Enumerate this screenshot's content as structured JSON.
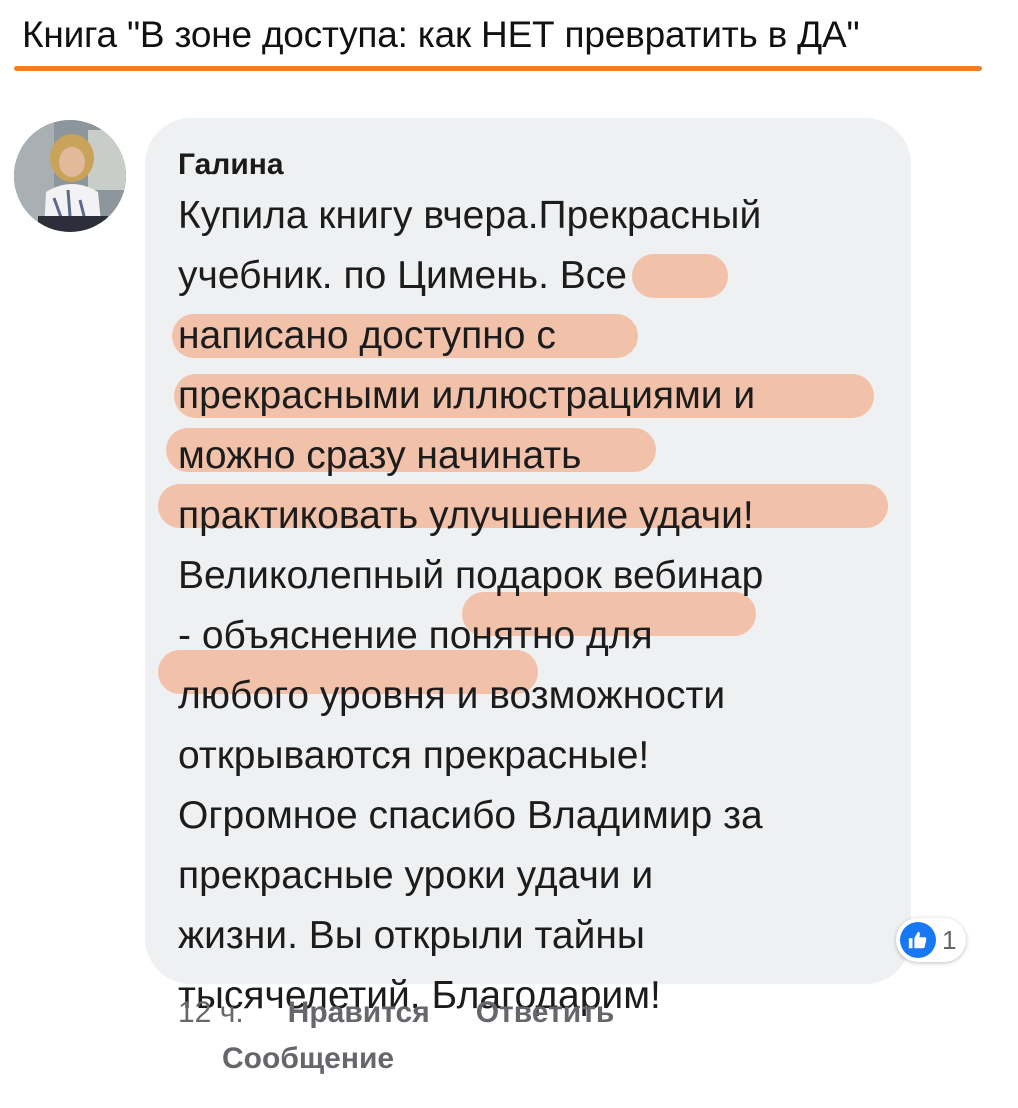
{
  "header": {
    "title": "Книга \"В зоне доступа: как НЕТ превратить в ДА\"",
    "underline_color": "#f07f2a"
  },
  "comment": {
    "author": "Галина",
    "lines": [
      "Купила книгу вчера.Прекрасный",
      "учебник.  по Цимень. Все",
      "написано доступно с",
      "прекрасными иллюстрациями и",
      "можно сразу начинать",
      "практиковать улучшение удачи!",
      "Великолепный подарок вебинар",
      "- объяснение понятно для",
      "любого уровня и возможности",
      "открываются прекрасные!",
      "Огромное спасибо Владимир за",
      "прекрасные уроки удачи и",
      "жизни. Вы открыли тайны",
      "тысячелетий. Благодарим!"
    ],
    "highlight_color": "#f2a57c",
    "bubble_color": "#eff0f2",
    "reaction": {
      "icon": "thumbs-up-icon",
      "color": "#1877f2",
      "count": "1"
    }
  },
  "actions": {
    "time": "12 ч.",
    "like": "Нравится",
    "reply": "Ответить",
    "message": "Сообщение"
  }
}
